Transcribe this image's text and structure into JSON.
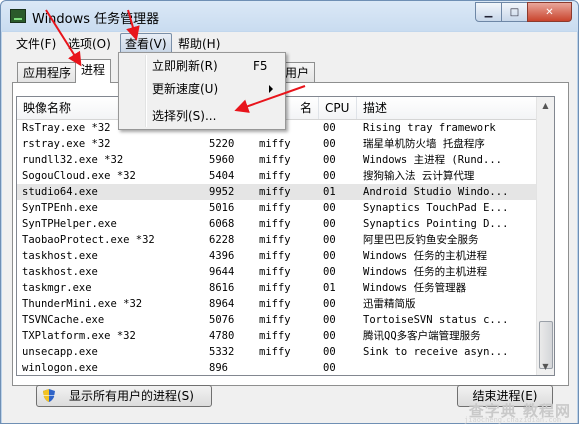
{
  "window": {
    "title": "Windows 任务管理器"
  },
  "menubar": {
    "file": "文件(F)",
    "options": "选项(O)",
    "view": "查看(V)",
    "help": "帮助(H)"
  },
  "tabs": [
    "应用程序",
    "进程",
    "用户"
  ],
  "view_menu": {
    "items": [
      {
        "label": "立即刷新(R)",
        "shortcut": "F5"
      },
      {
        "label": "更新速度(U)"
      },
      {
        "label": "选择列(S)..."
      }
    ]
  },
  "table": {
    "columns": {
      "name": "映像名称",
      "user": "名",
      "cpu": "CPU",
      "desc": "描述"
    },
    "rows": [
      {
        "name": "RsTray.exe *32",
        "pid": "",
        "user": "",
        "cpu": "00",
        "desc": "Rising tray framework"
      },
      {
        "name": "rstray.exe *32",
        "pid": "5220",
        "user": "miffy",
        "cpu": "00",
        "desc": "瑞星单机防火墙 托盘程序"
      },
      {
        "name": "rundll32.exe *32",
        "pid": "5960",
        "user": "miffy",
        "cpu": "00",
        "desc": "Windows 主进程 (Rund..."
      },
      {
        "name": "SogouCloud.exe *32",
        "pid": "5404",
        "user": "miffy",
        "cpu": "00",
        "desc": "搜狗输入法 云计算代理"
      },
      {
        "name": "studio64.exe",
        "pid": "9952",
        "user": "miffy",
        "cpu": "01",
        "desc": "Android Studio Windo..."
      },
      {
        "name": "SynTPEnh.exe",
        "pid": "5016",
        "user": "miffy",
        "cpu": "00",
        "desc": "Synaptics TouchPad E..."
      },
      {
        "name": "SynTPHelper.exe",
        "pid": "6068",
        "user": "miffy",
        "cpu": "00",
        "desc": "Synaptics Pointing D..."
      },
      {
        "name": "TaobaoProtect.exe *32",
        "pid": "6228",
        "user": "miffy",
        "cpu": "00",
        "desc": "阿里巴巴反钓鱼安全服务"
      },
      {
        "name": "taskhost.exe",
        "pid": "4396",
        "user": "miffy",
        "cpu": "00",
        "desc": "Windows 任务的主机进程"
      },
      {
        "name": "taskhost.exe",
        "pid": "9644",
        "user": "miffy",
        "cpu": "00",
        "desc": "Windows 任务的主机进程"
      },
      {
        "name": "taskmgr.exe",
        "pid": "8616",
        "user": "miffy",
        "cpu": "01",
        "desc": "Windows 任务管理器"
      },
      {
        "name": "ThunderMini.exe *32",
        "pid": "8964",
        "user": "miffy",
        "cpu": "00",
        "desc": "迅雷精简版"
      },
      {
        "name": "TSVNCache.exe",
        "pid": "5076",
        "user": "miffy",
        "cpu": "00",
        "desc": "TortoiseSVN status c..."
      },
      {
        "name": "TXPlatform.exe *32",
        "pid": "4780",
        "user": "miffy",
        "cpu": "00",
        "desc": "腾讯QQ多客户端管理服务"
      },
      {
        "name": "unsecapp.exe",
        "pid": "5332",
        "user": "miffy",
        "cpu": "00",
        "desc": "Sink to receive asyn..."
      },
      {
        "name": "winlogon.exe",
        "pid": "896",
        "user": "",
        "cpu": "00",
        "desc": ""
      }
    ]
  },
  "buttons": {
    "show_all": "显示所有用户的进程(S)",
    "end_process": "结束进程(E)"
  },
  "watermark": {
    "main": "查字典 教程网",
    "sub": "jiaocheng.chazidian.com"
  },
  "colors": {
    "annotation_arrow": "#e8141b",
    "selected_row": "#e5e5e5"
  }
}
